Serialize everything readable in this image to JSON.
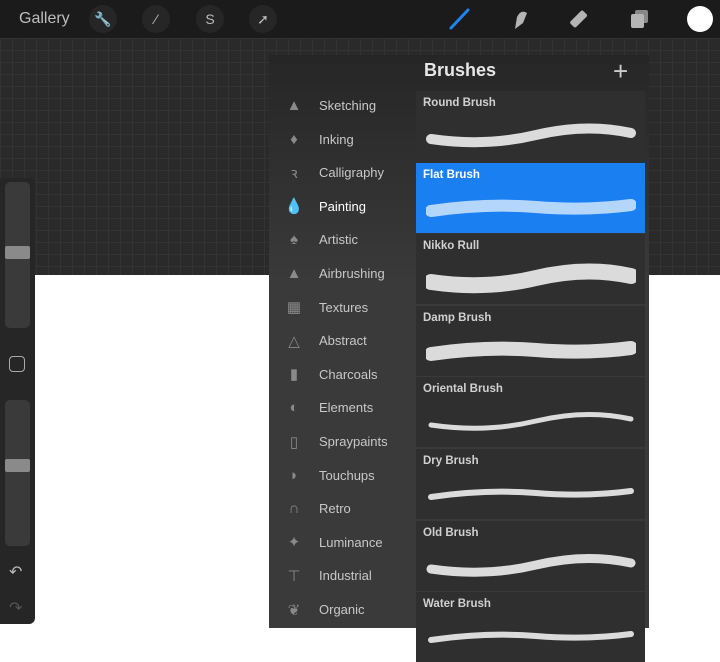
{
  "topbar": {
    "gallery": "Gallery",
    "left_tools": [
      "wrench-icon",
      "magic-wand-icon",
      "selection-icon",
      "move-arrow-icon"
    ],
    "right_tools": [
      "brush-icon",
      "smudge-icon",
      "eraser-icon",
      "layers-icon",
      "color-icon"
    ],
    "accent": "#1e84f5"
  },
  "panel": {
    "title": "Brushes",
    "add": "+"
  },
  "categories": [
    {
      "label": "Sketching",
      "icon": "▲"
    },
    {
      "label": "Inking",
      "icon": "♦"
    },
    {
      "label": "Calligraphy",
      "icon": "ꝛ"
    },
    {
      "label": "Painting",
      "icon": "💧",
      "selected": true
    },
    {
      "label": "Artistic",
      "icon": "♠"
    },
    {
      "label": "Airbrushing",
      "icon": "▲"
    },
    {
      "label": "Textures",
      "icon": "▦"
    },
    {
      "label": "Abstract",
      "icon": "△"
    },
    {
      "label": "Charcoals",
      "icon": "▮"
    },
    {
      "label": "Elements",
      "icon": "◐"
    },
    {
      "label": "Spraypaints",
      "icon": "▯"
    },
    {
      "label": "Touchups",
      "icon": "◗"
    },
    {
      "label": "Retro",
      "icon": "∩"
    },
    {
      "label": "Luminance",
      "icon": "✦"
    },
    {
      "label": "Industrial",
      "icon": "⊤"
    },
    {
      "label": "Organic",
      "icon": "❦"
    }
  ],
  "brushes": [
    {
      "name": "Round Brush"
    },
    {
      "name": "Flat Brush",
      "selected": true
    },
    {
      "name": "Nikko Rull"
    },
    {
      "name": "Damp Brush"
    },
    {
      "name": "Oriental Brush"
    },
    {
      "name": "Dry Brush"
    },
    {
      "name": "Old Brush"
    },
    {
      "name": "Water Brush"
    }
  ]
}
